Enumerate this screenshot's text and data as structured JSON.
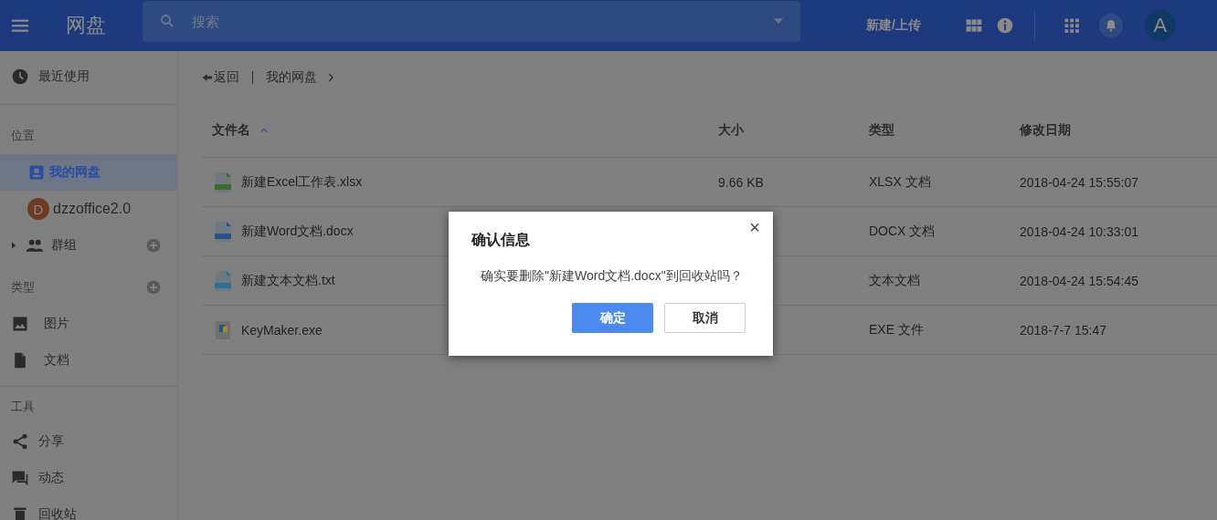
{
  "header": {
    "title": "网盘",
    "search": {
      "placeholder": "搜索"
    },
    "upload_label": "新建/上传",
    "avatar": "A"
  },
  "sidebar": {
    "sections": [
      {
        "items": [
          {
            "kind": "recent",
            "label": "最近使用",
            "selected": false
          }
        ]
      },
      {
        "items": [
          {
            "kind": "heading",
            "label": "位置"
          },
          {
            "kind": "drive",
            "label": "我的网盘",
            "selected": true
          },
          {
            "kind": "account",
            "label": "dzzoffice2.0",
            "letter": "D",
            "selected": false
          },
          {
            "kind": "group",
            "label": "群组",
            "selected": false,
            "expanded": false,
            "addable": true
          },
          {
            "kind": "heading",
            "label": "类型",
            "addable": true
          },
          {
            "kind": "images",
            "label": "图片",
            "selected": false
          },
          {
            "kind": "docs",
            "label": "文档",
            "selected": false
          }
        ]
      },
      {
        "items": [
          {
            "kind": "heading",
            "label": "工具"
          },
          {
            "kind": "share",
            "label": "分享",
            "selected": false
          },
          {
            "kind": "activity",
            "label": "动态",
            "selected": false
          },
          {
            "kind": "trash",
            "label": "回收站",
            "selected": false
          }
        ]
      }
    ]
  },
  "breadcrumb": {
    "back": "返回",
    "path": [
      "我的网盘"
    ]
  },
  "table": {
    "columns": [
      {
        "label": "文件名",
        "sort_ascending": true
      },
      {
        "label": "大小"
      },
      {
        "label": "类型"
      },
      {
        "label": "修改日期"
      }
    ],
    "rows": [
      {
        "kind": "xlsx",
        "name": "新建Excel工作表.xlsx",
        "size": "9.66 KB",
        "type": "XLSX 文档",
        "modified": "2018-04-24 15:55:07"
      },
      {
        "kind": "docx",
        "name": "新建Word文档.docx",
        "type": "DOCX 文档",
        "modified": "2018-04-24 10:33:01"
      },
      {
        "kind": "txt",
        "name": "新建文本文档.txt",
        "type": "文本文档",
        "modified": "2018-04-24 15:54:45"
      },
      {
        "kind": "exe",
        "name": "KeyMaker.exe",
        "type": "EXE 文件",
        "modified": "2018-7-7 15:47"
      }
    ]
  },
  "dialog": {
    "title": "确认信息",
    "close": "×",
    "message": "确实要删除\"新建Word文档.docx\"到回收站吗？",
    "buttons": [
      {
        "kind": "primary",
        "label": "确定"
      },
      {
        "kind": "default",
        "label": "取消"
      }
    ]
  }
}
